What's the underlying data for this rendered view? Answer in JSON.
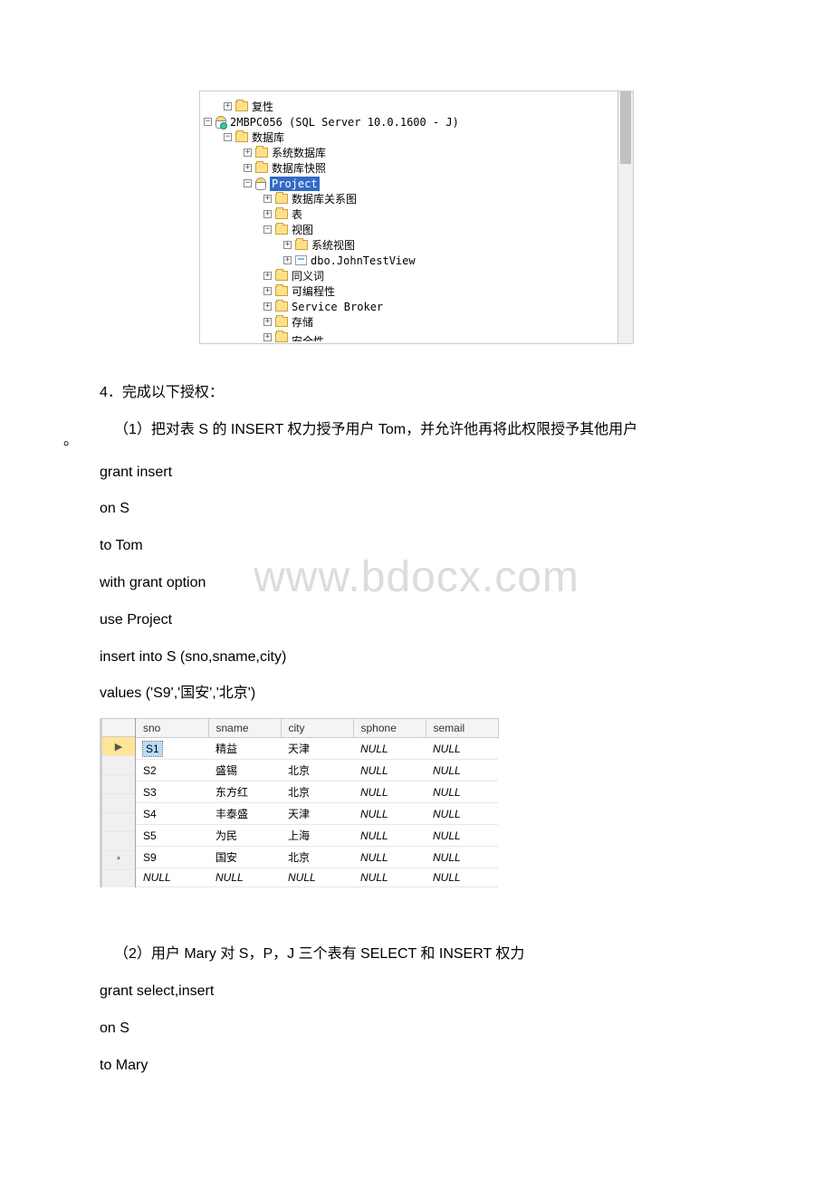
{
  "tree": {
    "server": "2MBPC056 (SQL Server 10.0.1600 - J)",
    "root_partial": "复性",
    "databases": "数据库",
    "sysdb": "系统数据库",
    "dbsnapshot": "数据库快照",
    "project": "Project",
    "diagrams": "数据库关系图",
    "tables": "表",
    "views": "视图",
    "sysviews": "系统视图",
    "johntestview": "dbo.JohnTestView",
    "synonyms": "同义词",
    "programmability": "可编程性",
    "servicebroker": "Service Broker",
    "storage": "存储",
    "security_partial": "安全性"
  },
  "content": {
    "section4": "4．完成以下授权：",
    "q1": "（1）把对表 S 的 INSERT 权力授予用户 Tom，并允许他再将此权限授予其他用户",
    "period": "。",
    "sql1a": "grant insert",
    "sql1b": "on S",
    "sql1c": "to Tom",
    "sql1d": "with grant option",
    "sql1e": "use Project",
    "sql1f": "insert into S (sno,sname,city)",
    "sql1g": "values ('S9','国安','北京')",
    "q2": "（2）用户 Mary 对 S，P，J 三个表有 SELECT 和 INSERT 权力",
    "sql2a": "grant select,insert",
    "sql2b": "on S",
    "sql2c": "to Mary"
  },
  "watermark": "www.bdocx.com",
  "table": {
    "headers": [
      "sno",
      "sname",
      "city",
      "sphone",
      "semail"
    ],
    "rowmarkers": [
      "▶",
      "",
      "",
      "",
      "",
      "",
      "*"
    ],
    "rows": [
      [
        "S1",
        "精益",
        "天津",
        "NULL",
        "NULL"
      ],
      [
        "S2",
        "盛锡",
        "北京",
        "NULL",
        "NULL"
      ],
      [
        "S3",
        "东方红",
        "北京",
        "NULL",
        "NULL"
      ],
      [
        "S4",
        "丰泰盛",
        "天津",
        "NULL",
        "NULL"
      ],
      [
        "S5",
        "为民",
        "上海",
        "NULL",
        "NULL"
      ],
      [
        "S9",
        "国安",
        "北京",
        "NULL",
        "NULL"
      ],
      [
        "NULL",
        "NULL",
        "NULL",
        "NULL",
        "NULL"
      ]
    ]
  }
}
